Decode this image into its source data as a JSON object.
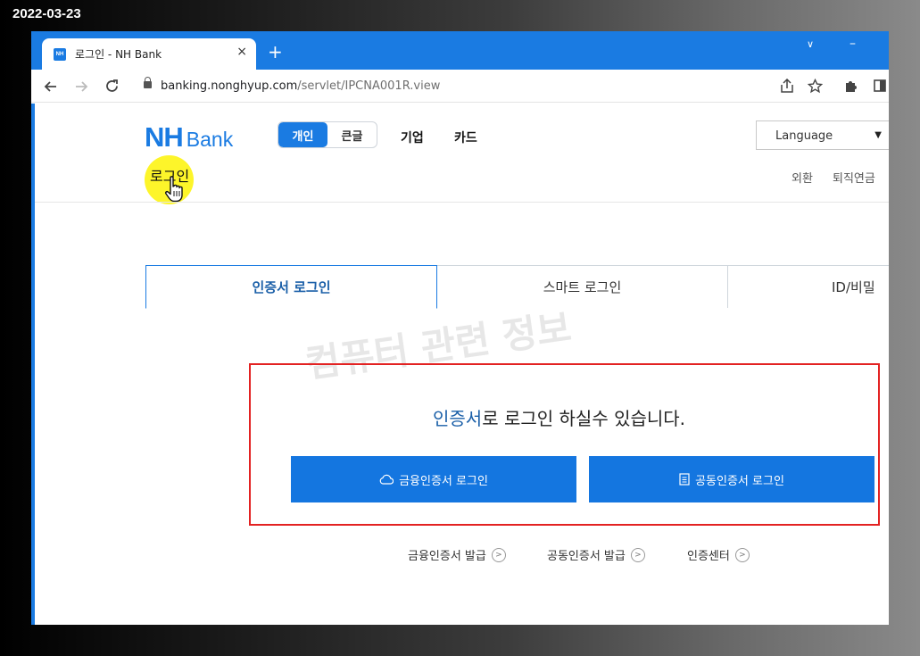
{
  "date_stamp": "2022-03-23",
  "browser": {
    "tab_title": "로그인 - NH Bank",
    "favicon_text": "NH",
    "tab_close": "×",
    "new_tab": "+",
    "tab_search": "∨",
    "window_minimize": "–",
    "url_host": "banking.nonghyup.com",
    "url_path": "/servlet/IPCNA001R.view"
  },
  "header": {
    "logo_nh": "NH",
    "logo_bank": "Bank",
    "segment": [
      "개인",
      "큰글"
    ],
    "menu": [
      "기업",
      "카드"
    ],
    "language_label": "Language",
    "language_caret": "▼",
    "login_link": "로그인",
    "util_links": [
      "외환",
      "퇴직연금"
    ]
  },
  "login_tabs": [
    "인증서 로그인",
    "스마트 로그인",
    "ID/비밀"
  ],
  "watermark": "컴퓨터 관련 정보",
  "message": {
    "accent": "인증서",
    "rest": "로 로그인 하실수 있습니다."
  },
  "buttons": {
    "financial_cert": "금융인증서 로그인",
    "joint_cert": "공동인증서 로그인"
  },
  "bottom_links": [
    "금융인증서 발급",
    "공동인증서 발급",
    "인증센터"
  ],
  "icons": {
    "back": "back-arrow-icon",
    "forward": "forward-arrow-icon",
    "reload": "reload-icon",
    "share": "share-icon",
    "star": "star-icon",
    "extensions": "puzzle-icon",
    "sidebar": "sidebar-icon",
    "cloud": "cloud-icon",
    "document": "document-icon",
    "cursor": "hand-pointer-icon"
  },
  "colors": {
    "brand_blue": "#1a7be2",
    "highlight_yellow": "#fdf52a",
    "red_box": "#e32222"
  }
}
